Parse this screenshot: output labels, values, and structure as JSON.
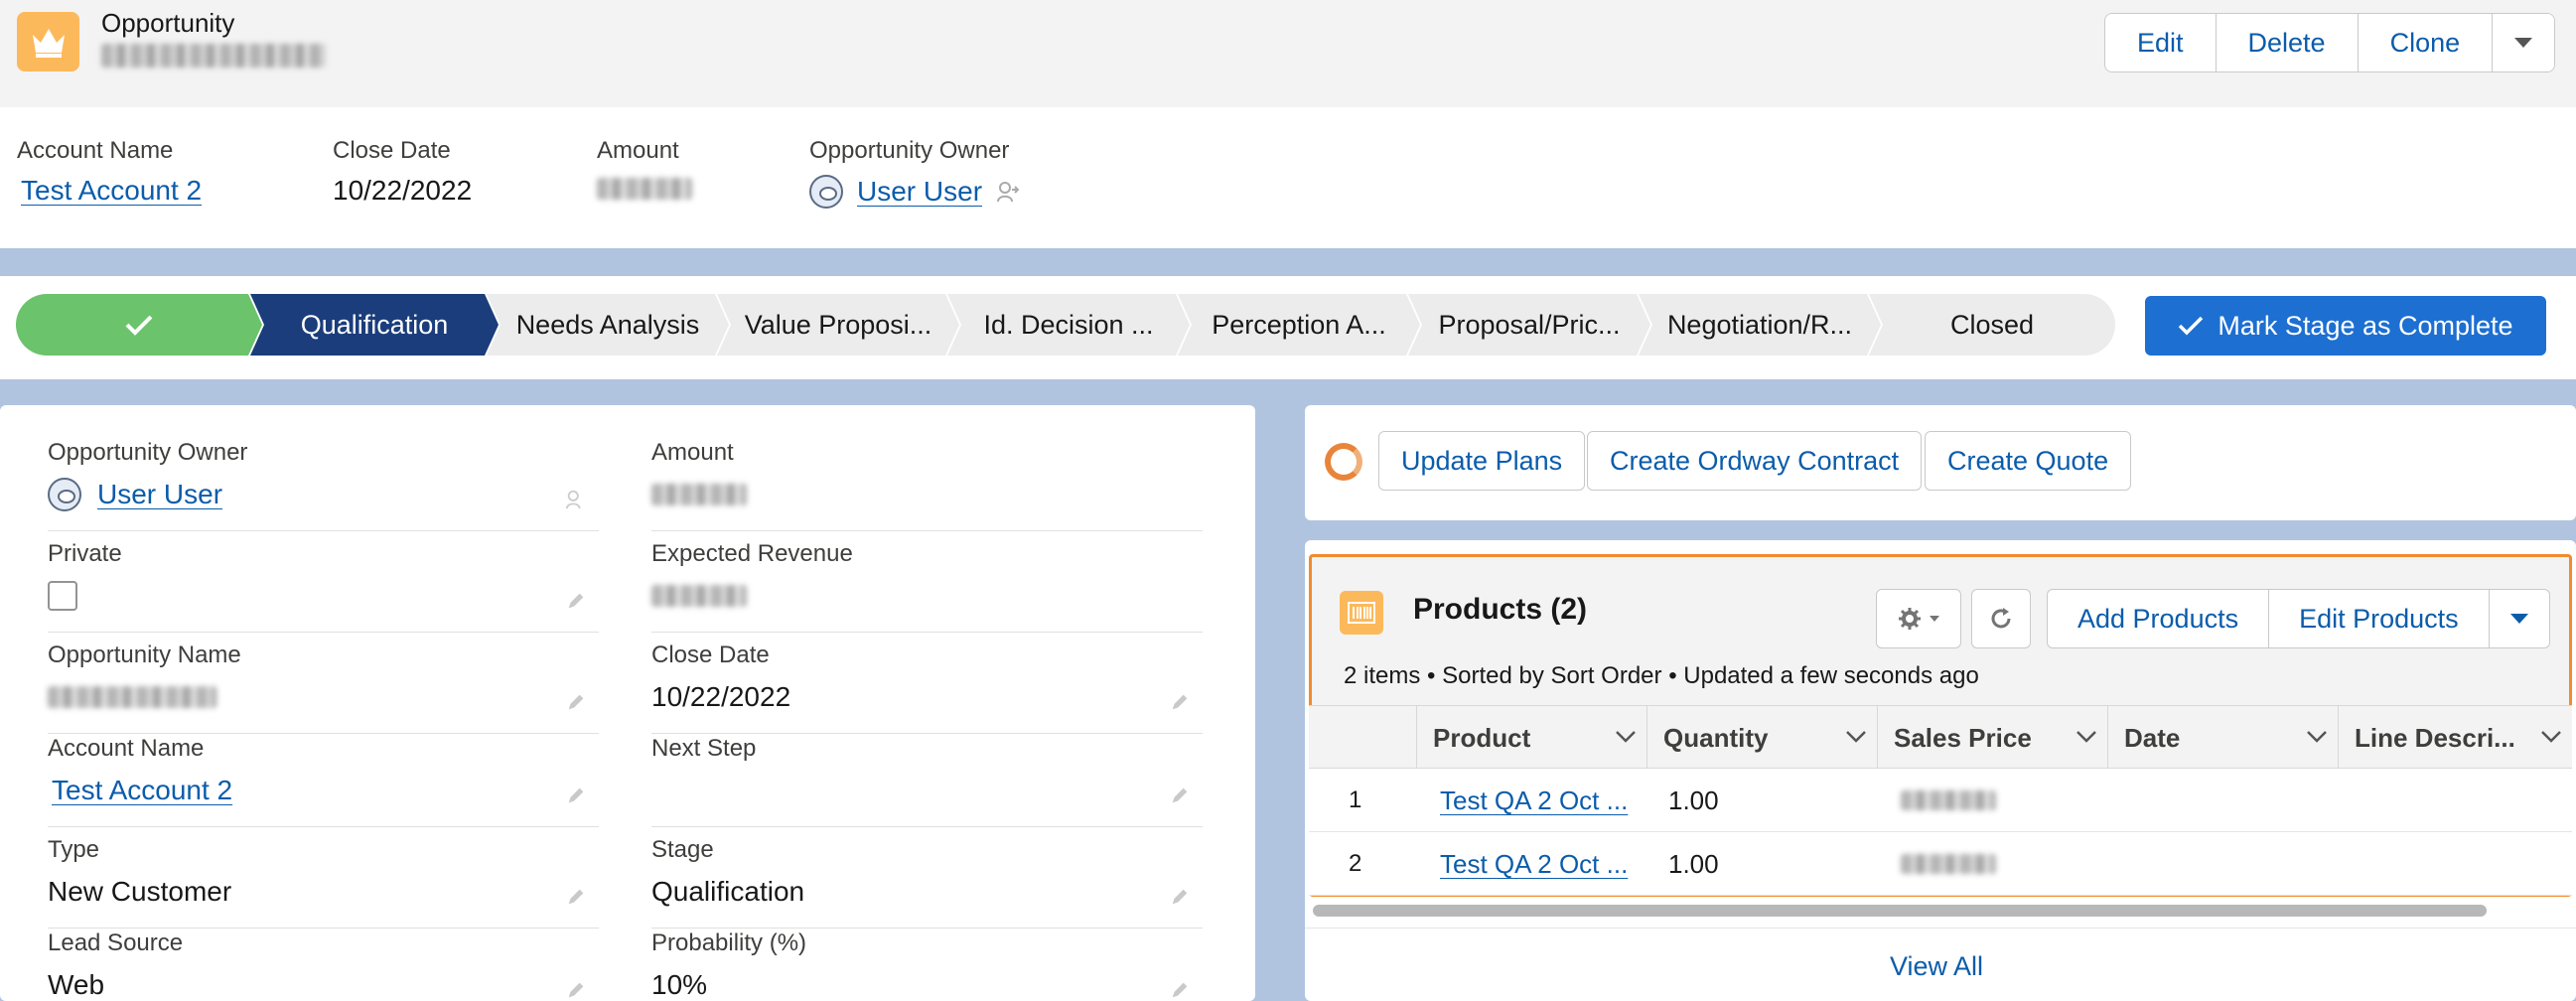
{
  "header": {
    "object_label": "Opportunity",
    "buttons": {
      "edit": "Edit",
      "delete": "Delete",
      "clone": "Clone"
    },
    "highlights": [
      {
        "label": "Account Name",
        "value": "Test Account 2",
        "kind": "link"
      },
      {
        "label": "Close Date",
        "value": "10/22/2022",
        "kind": "text"
      },
      {
        "label": "Amount",
        "value": "",
        "kind": "redacted"
      },
      {
        "label": "Opportunity Owner",
        "value": "User User",
        "kind": "user"
      }
    ]
  },
  "path": {
    "stages": [
      "Qualification",
      "Needs Analysis",
      "Value Proposi...",
      "Id. Decision ...",
      "Perception A...",
      "Proposal/Pric...",
      "Negotiation/R...",
      "Closed"
    ],
    "mark_button": "Mark Stage as Complete"
  },
  "details": {
    "left": [
      {
        "label": "Opportunity Owner",
        "value": "User User",
        "kind": "user"
      },
      {
        "label": "Private",
        "value": "",
        "kind": "checkbox",
        "checked": false
      },
      {
        "label": "Opportunity Name",
        "value": "",
        "kind": "redacted"
      },
      {
        "label": "Account Name",
        "value": "Test Account 2",
        "kind": "link"
      },
      {
        "label": "Type",
        "value": "New Customer",
        "kind": "text"
      },
      {
        "label": "Lead Source",
        "value": "Web",
        "kind": "text"
      }
    ],
    "right": [
      {
        "label": "Amount",
        "value": "",
        "kind": "redacted"
      },
      {
        "label": "Expected Revenue",
        "value": "",
        "kind": "redacted"
      },
      {
        "label": "Close Date",
        "value": "10/22/2022",
        "kind": "text"
      },
      {
        "label": "Next Step",
        "value": "",
        "kind": "text"
      },
      {
        "label": "Stage",
        "value": "Qualification",
        "kind": "text"
      },
      {
        "label": "Probability (%)",
        "value": "10%",
        "kind": "text"
      }
    ]
  },
  "actions": {
    "update_plans": "Update Plans",
    "create_contract": "Create Ordway Contract",
    "create_quote": "Create Quote"
  },
  "products": {
    "title": "Products (2)",
    "meta": "2 items • Sorted by Sort Order • Updated a few seconds ago",
    "add_button": "Add Products",
    "edit_button": "Edit Products",
    "columns": [
      "Product",
      "Quantity",
      "Sales Price",
      "Date",
      "Line Descri..."
    ],
    "rows": [
      {
        "num": "1",
        "product": "Test QA 2 Oct ...",
        "quantity": "1.00"
      },
      {
        "num": "2",
        "product": "Test QA 2 Oct ...",
        "quantity": "1.00"
      }
    ],
    "view_all": "View All"
  },
  "colors": {
    "brand": "#1d6fd1",
    "path_current": "#1b3d7b",
    "path_complete": "#6bc36b",
    "highlight": "#f28b2d",
    "object_icon": "#fcb95b"
  },
  "icons": [
    "crown-icon",
    "checkmark-icon",
    "chevron-down-icon",
    "pencil-icon",
    "gear-icon",
    "refresh-icon",
    "barcode-icon",
    "user-avatar-icon",
    "change-owner-icon"
  ]
}
